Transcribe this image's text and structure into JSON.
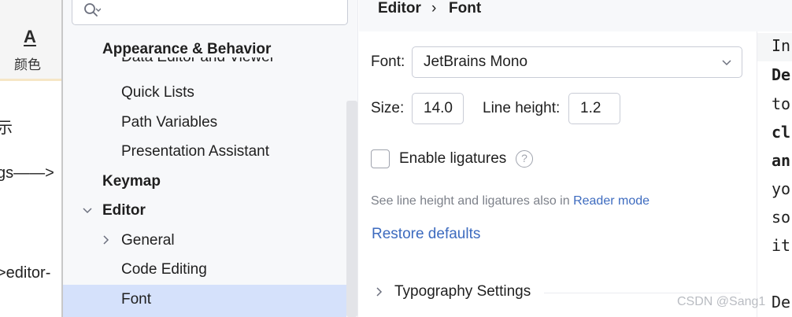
{
  "background_app": {
    "color_label": "颜色",
    "color_icon_glyph": "A",
    "text_fragments": [
      "示",
      "gs——>",
      ">editor-"
    ]
  },
  "sidebar": {
    "search": {
      "value": "",
      "placeholder": ""
    },
    "sticky_header": "Appearance & Behavior",
    "items": [
      {
        "label": "Data Editor and Viewer",
        "level": 1
      },
      {
        "label": "Quick Lists",
        "level": 1
      },
      {
        "label": "Path Variables",
        "level": 1
      },
      {
        "label": "Presentation Assistant",
        "level": 1
      },
      {
        "label": "Keymap",
        "level": 0
      },
      {
        "label": "Editor",
        "level": 0,
        "expanded": true
      },
      {
        "label": "General",
        "level": 1,
        "expanded": false
      },
      {
        "label": "Code Editing",
        "level": 1
      },
      {
        "label": "Font",
        "level": 1,
        "selected": true
      }
    ]
  },
  "breadcrumb": [
    "Editor",
    "Font"
  ],
  "breadcrumb_separator": "›",
  "font_settings": {
    "font_label": "Font:",
    "font_value": "JetBrains Mono",
    "size_label": "Size:",
    "size_value": "14.0",
    "line_height_label": "Line height:",
    "line_height_value": "1.2",
    "ligatures_label": "Enable ligatures",
    "ligatures_checked": false,
    "help_glyph": "?",
    "hint_text": "See line height and ligatures also in ",
    "hint_link": "Reader mode",
    "restore_defaults": "Restore defaults",
    "typography_settings": "Typography Settings"
  },
  "preview_lines": [
    {
      "text": "In",
      "bold": false
    },
    {
      "text": "De",
      "bold": true
    },
    {
      "text": "to",
      "bold": false
    },
    {
      "text": "cl",
      "bold": true
    },
    {
      "text": "an",
      "bold": true
    },
    {
      "text": "yo",
      "bold": false
    },
    {
      "text": "so",
      "bold": false
    },
    {
      "text": "it",
      "bold": false
    },
    {
      "text": "De",
      "bold": false
    }
  ],
  "watermark": "CSDN @Sang1",
  "colors": {
    "accent_link": "#3d6bbf",
    "selection": "#d5e1fb",
    "sidebar_bg": "#f7f8fa"
  }
}
